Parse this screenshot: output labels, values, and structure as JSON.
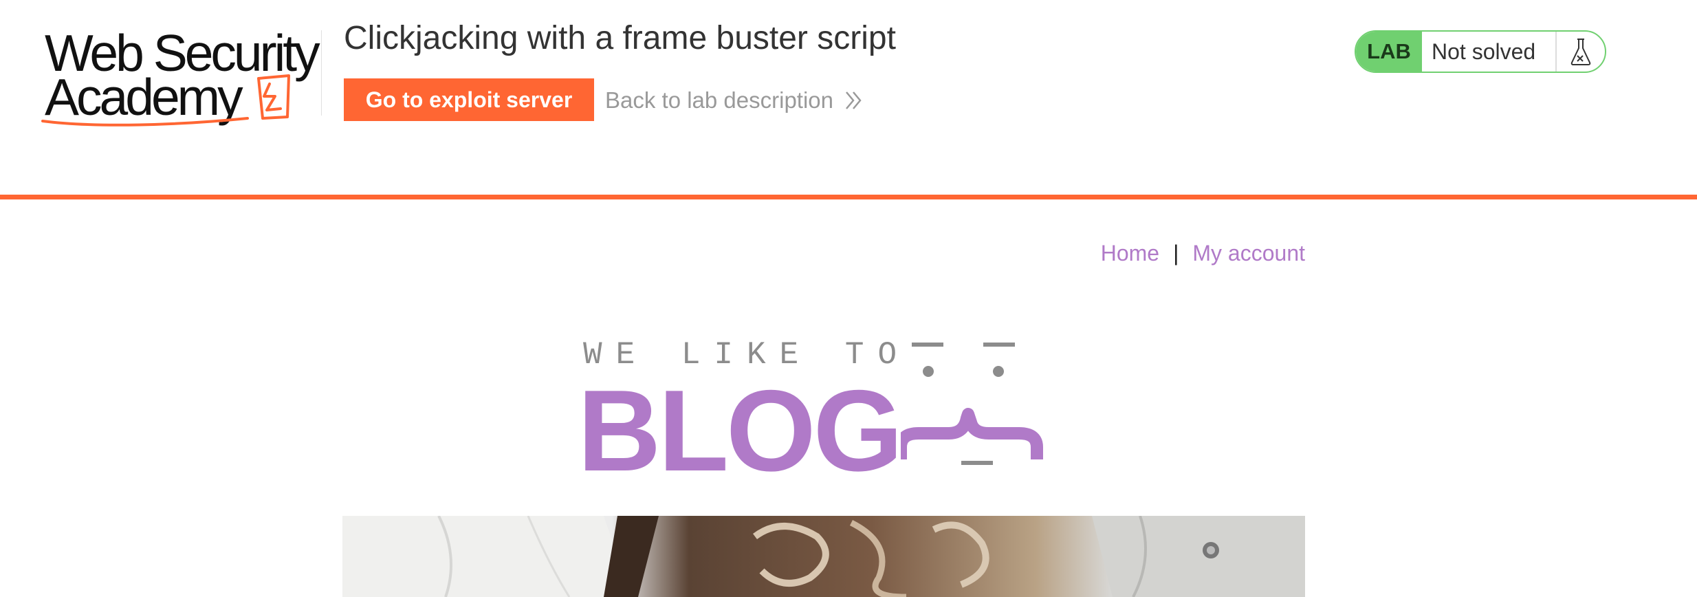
{
  "academy": {
    "logo_line1": "Web Security",
    "logo_line2": "Academy",
    "lab_title": "Clickjacking with a frame buster script",
    "exploit_button": "Go to exploit server",
    "back_link": "Back to lab description",
    "lab_badge": "LAB",
    "lab_status": "Not solved",
    "status_icon": "flask-icon"
  },
  "nav": {
    "home": "Home",
    "separator": "|",
    "my_account": "My account"
  },
  "banner": {
    "tagline": "WE LIKE TO",
    "title": "BLOG"
  },
  "colors": {
    "accent": "#ff6633",
    "lab_green": "#70d070",
    "link_purple": "#b07ac8",
    "gray_text": "#999999"
  }
}
